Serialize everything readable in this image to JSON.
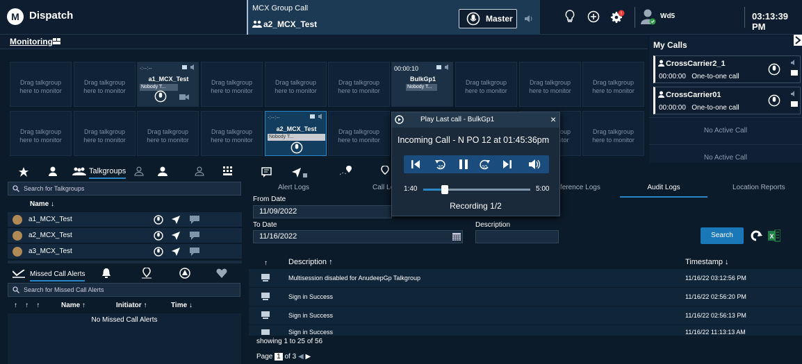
{
  "topbar": {
    "title": "Dispatch",
    "mcx_label": "MCX Group Call",
    "mcx_group": "a2_MCX_Test",
    "master_label": "Master",
    "user": "Wd5",
    "clock": "03:13:39 PM",
    "notif_color": "#e53935"
  },
  "monitoring": {
    "label": "Monitoring",
    "drag_line1": "Drag talkgroup",
    "drag_line2": "here to monitor",
    "active_tiles": [
      {
        "time": "-:--:--",
        "name": "a1_MCX_Test",
        "speaker": "Nobody T..."
      },
      {
        "time": "-:--:--",
        "name": "a2_MCX_Test",
        "speaker": "Nobody T..."
      },
      {
        "time": "00:00:10",
        "name": "BulkGp1",
        "speaker": "Nobody T..."
      }
    ],
    "partial_tile_1": "oup",
    "partial_tile_2": "itor"
  },
  "my_calls": {
    "title": "My Calls",
    "calls": [
      {
        "name": "CrossCarrier2_1",
        "time": "00:00:00",
        "type": "One-to-one call"
      },
      {
        "name": "CrossCarrier01",
        "time": "00:00:00",
        "type": "One-to-one call"
      }
    ],
    "no_active": "No Active Call"
  },
  "talkgroups": {
    "tab_label": "Talkgroups",
    "search_placeholder": "Search for Talkgroups",
    "column_name": "Name ↓",
    "items": [
      "a1_MCX_Test",
      "a2_MCX_Test",
      "a3_MCX_Test"
    ]
  },
  "missed": {
    "tab_label": "Missed Call Alerts",
    "search_placeholder": "Search for Missed Call Alerts",
    "col_name": "Name ↑",
    "col_initiator": "Initiator ↑",
    "col_time": "Time ↓",
    "empty": "No Missed Call Alerts"
  },
  "logs": {
    "tabs": [
      "Alert Logs",
      "Call Lo",
      "ference Logs",
      "Audit Logs",
      "Location Reports"
    ],
    "from_label": "From Date",
    "from_value": "11/09/2022",
    "to_label": "To Date",
    "to_value": "11/16/2022",
    "desc_label": "Description",
    "search_button": "Search",
    "col_desc": "Description ↑",
    "col_time": "Timestamp ↓",
    "rows": [
      {
        "desc": "Multisession disabled for AnudeepGp Talkgroup",
        "time": "11/16/22 03:12:56 PM"
      },
      {
        "desc": "Sign in Success",
        "time": "11/16/22 02:56:20 PM"
      },
      {
        "desc": "Sign in Success",
        "time": "11/16/22 02:56:13 PM"
      },
      {
        "desc": "Sign in Success",
        "time": "11/16/22 11:13:13 AM"
      }
    ],
    "showing": "showing 1 to 25 of 56",
    "page_prefix": "Page",
    "page_current": "1",
    "page_suffix": "of 3"
  },
  "popup": {
    "title": "Play Last call - BulkGp1",
    "incoming": "Incoming Call - N PO 12 at 01:45:36pm",
    "start": "1:40",
    "end": "5:00",
    "progress": 0.2,
    "recording": "Recording 1/2",
    "close": "×",
    "skip_back_label": "10",
    "skip_fwd_label": "10"
  }
}
